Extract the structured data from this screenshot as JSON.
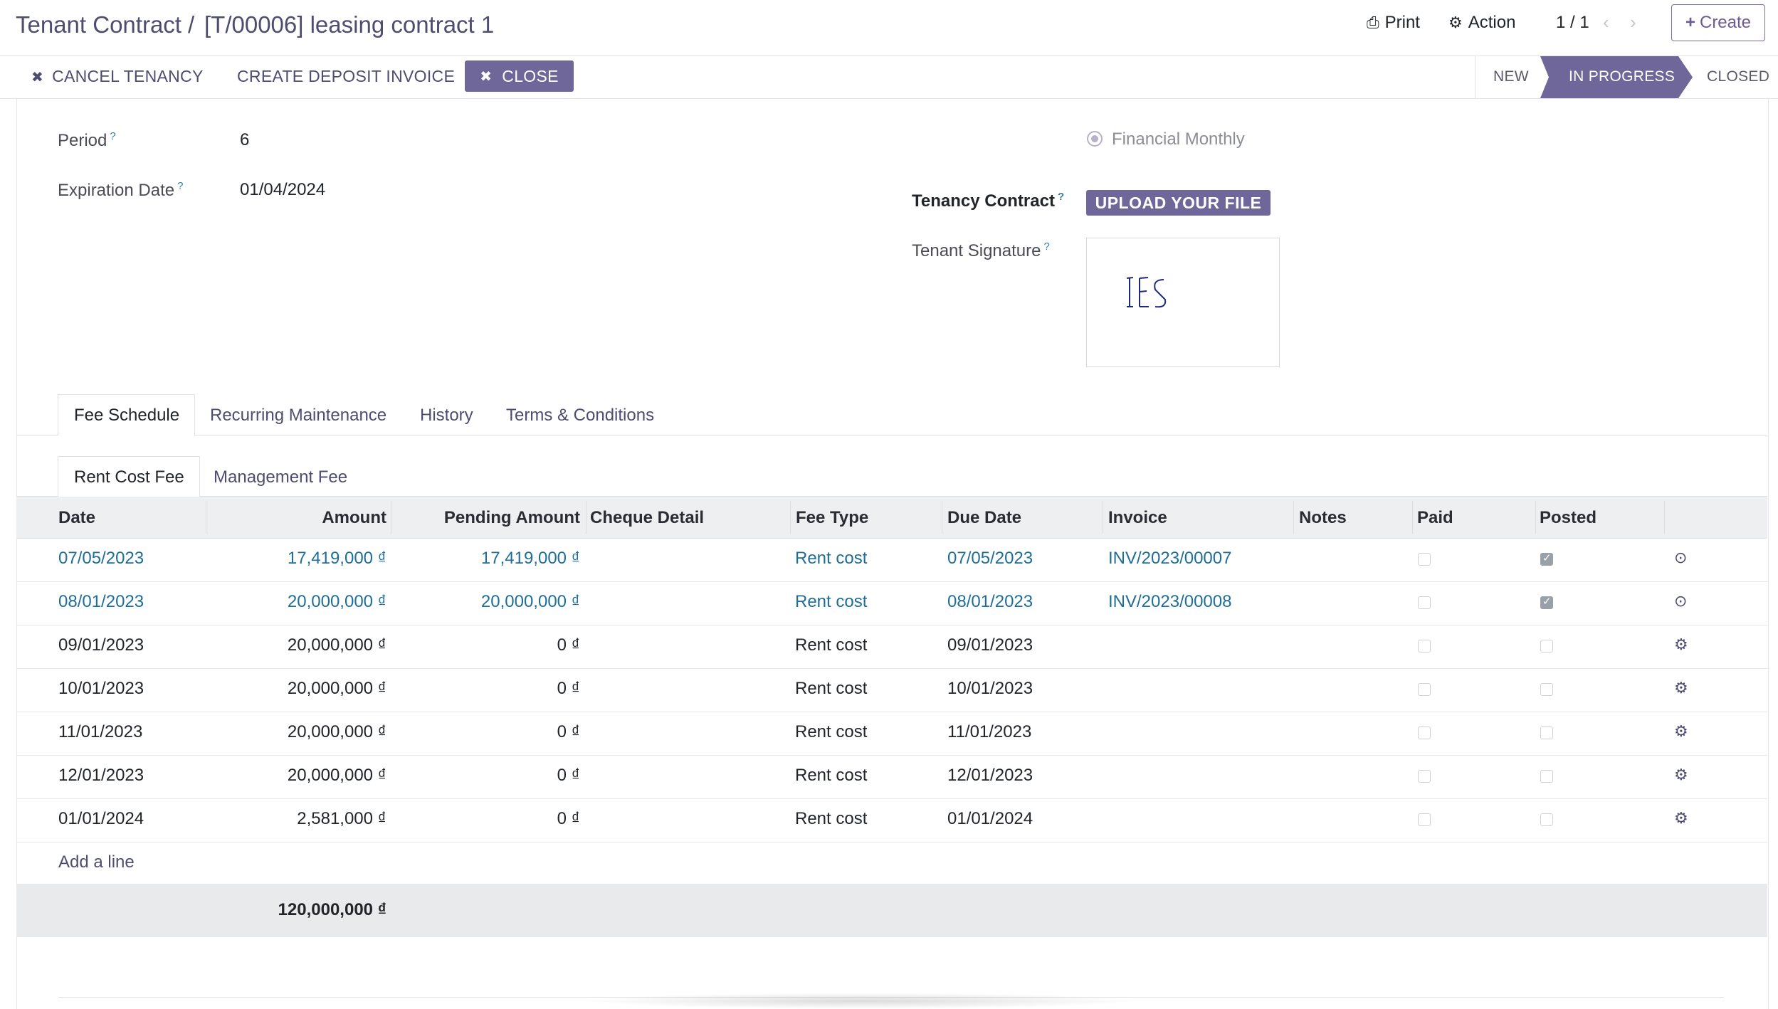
{
  "header": {
    "breadcrumb_parent": "Tenant Contract",
    "breadcrumb_sep": "/",
    "breadcrumb_current": "[T/00006] leasing contract 1",
    "print_label": "Print",
    "action_label": "Action",
    "pager": "1 / 1",
    "create_label": "Create"
  },
  "actions": {
    "cancel_tenancy": "CANCEL TENANCY",
    "create_deposit_invoice": "CREATE DEPOSIT INVOICE",
    "close": "CLOSE"
  },
  "statusbar": {
    "stages": [
      "NEW",
      "IN PROGRESS",
      "CLOSED"
    ],
    "active": "IN PROGRESS",
    "active_color": "#6f6799"
  },
  "form": {
    "period_label": "Period",
    "period_value": "6",
    "expiration_label": "Expiration Date",
    "expiration_value": "01/04/2024",
    "radio_option": "Financial Monthly",
    "tenancy_contract_label": "Tenancy Contract",
    "upload_label": "UPLOAD YOUR FILE",
    "tenant_signature_label": "Tenant Signature",
    "signature_text": "TES",
    "help_mark": "?"
  },
  "tabs": [
    "Fee Schedule",
    "Recurring Maintenance",
    "History",
    "Terms & Conditions"
  ],
  "subtabs": [
    "Rent Cost Fee",
    "Management Fee"
  ],
  "table": {
    "columns": [
      "Date",
      "Amount",
      "Pending Amount",
      "Cheque Detail",
      "Fee Type",
      "Due Date",
      "Invoice",
      "Notes",
      "Paid",
      "Posted"
    ],
    "rows": [
      {
        "date": "07/05/2023",
        "amount": "17,419,000 ₫",
        "pending": "17,419,000 ₫",
        "cheque": "",
        "fee_type": "Rent cost",
        "due": "07/05/2023",
        "invoice": "INV/2023/00007",
        "notes": "",
        "paid": false,
        "posted": true,
        "icon": "⊙"
      },
      {
        "date": "08/01/2023",
        "amount": "20,000,000 ₫",
        "pending": "20,000,000 ₫",
        "cheque": "",
        "fee_type": "Rent cost",
        "due": "08/01/2023",
        "invoice": "INV/2023/00008",
        "notes": "",
        "paid": false,
        "posted": true,
        "icon": "⊙"
      },
      {
        "date": "09/01/2023",
        "amount": "20,000,000 ₫",
        "pending": "0 ₫",
        "cheque": "",
        "fee_type": "Rent cost",
        "due": "09/01/2023",
        "invoice": "",
        "notes": "",
        "paid": false,
        "posted": false,
        "icon": "⚙"
      },
      {
        "date": "10/01/2023",
        "amount": "20,000,000 ₫",
        "pending": "0 ₫",
        "cheque": "",
        "fee_type": "Rent cost",
        "due": "10/01/2023",
        "invoice": "",
        "notes": "",
        "paid": false,
        "posted": false,
        "icon": "⚙"
      },
      {
        "date": "11/01/2023",
        "amount": "20,000,000 ₫",
        "pending": "0 ₫",
        "cheque": "",
        "fee_type": "Rent cost",
        "due": "11/01/2023",
        "invoice": "",
        "notes": "",
        "paid": false,
        "posted": false,
        "icon": "⚙"
      },
      {
        "date": "12/01/2023",
        "amount": "20,000,000 ₫",
        "pending": "0 ₫",
        "cheque": "",
        "fee_type": "Rent cost",
        "due": "12/01/2023",
        "invoice": "",
        "notes": "",
        "paid": false,
        "posted": false,
        "icon": "⚙"
      },
      {
        "date": "01/01/2024",
        "amount": "2,581,000 ₫",
        "pending": "0 ₫",
        "cheque": "",
        "fee_type": "Rent cost",
        "due": "01/01/2024",
        "invoice": "",
        "notes": "",
        "paid": false,
        "posted": false,
        "icon": "⚙"
      }
    ],
    "add_line": "Add a line",
    "total_amount": "120,000,000 ₫"
  },
  "icons": {
    "print": "printer-icon",
    "action": "gear-icon",
    "prev": "chevron-left-icon",
    "next": "chevron-right-icon",
    "create": "plus-icon",
    "cancel": "times-icon",
    "close": "times-icon"
  },
  "colors": {
    "brand": "#6f6799",
    "link": "#1f6e99"
  }
}
